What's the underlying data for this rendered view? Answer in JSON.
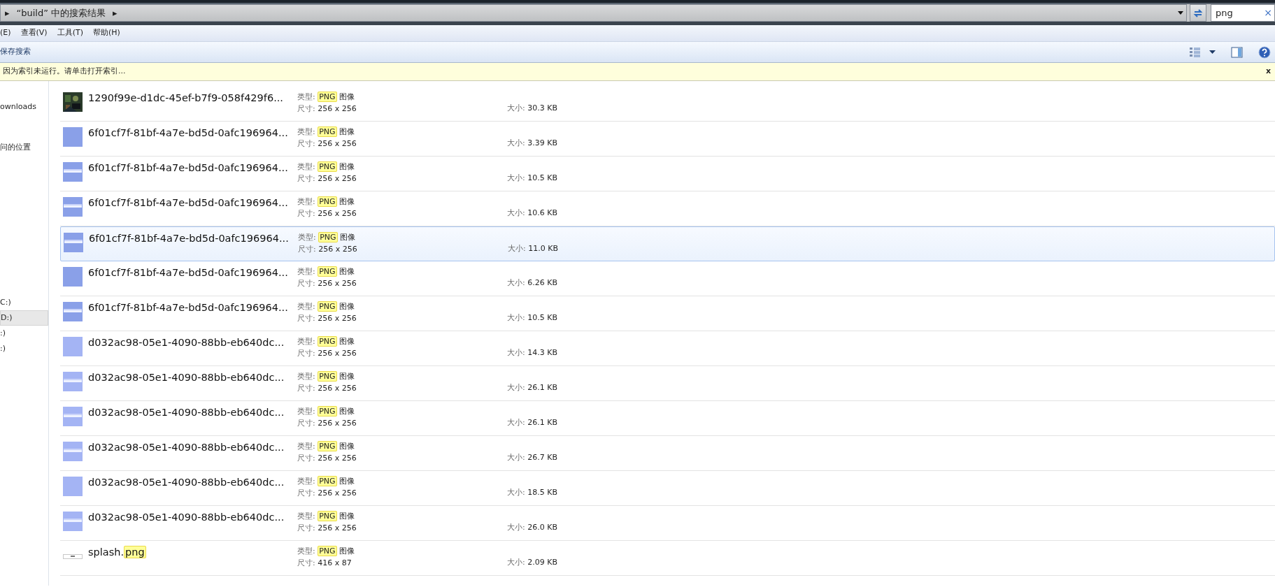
{
  "address": {
    "arrow_left": "▸",
    "text": "“build” 中的搜索结果",
    "arrow_right": "▸"
  },
  "search": {
    "value": "png",
    "clear": "×"
  },
  "menu": [
    "(E)",
    "查看(V)",
    "工具(T)",
    "帮助(H)"
  ],
  "toolbar": {
    "save_search": "保存搜索"
  },
  "info_bar": {
    "text": "因为索引未运行。请单击打开索引...",
    "close": "x"
  },
  "sidebar": [
    {
      "label": "ownloads",
      "selected": false,
      "gap": false
    },
    {
      "label": "问的位置",
      "selected": false,
      "gap": true
    },
    {
      "label": "C:)",
      "selected": false,
      "gap": true
    },
    {
      "label": "D:)",
      "selected": true,
      "gap": false
    },
    {
      "label": ":)",
      "selected": false,
      "gap": false
    },
    {
      "label": ":)",
      "selected": false,
      "gap": false
    }
  ],
  "files": [
    {
      "selected": false,
      "name_parts": [
        {
          "text": "1290f99e-d1dc-45ef-b7f9-058f429f6...",
          "highlighted": false
        }
      ],
      "type_label": "类型:",
      "type_parts": [
        {
          "text": "PNG",
          "highlighted": true
        },
        {
          "text": "图像",
          "highlighted": false
        }
      ],
      "dim_label": "尺寸:",
      "dims": "256 x 256",
      "size_label": "大小:",
      "size": "30.3 KB"
    },
    {
      "kind": "plain",
      "color": "#8aa0e8",
      "selected": false,
      "name_parts": [
        {
          "text": "6f01cf7f-81bf-4a7e-bd5d-0afc196964...",
          "highlighted": false
        }
      ],
      "type_label": "类型:",
      "type_parts": [
        {
          "text": "PNG",
          "highlighted": true
        },
        {
          "text": "图像",
          "highlighted": false
        }
      ],
      "dim_label": "尺寸:",
      "dims": "256 x 256",
      "size_label": "大小:",
      "size": "3.39 KB"
    },
    {
      "kind": "striped",
      "color": "#8aa0e8",
      "selected": false,
      "name_parts": [
        {
          "text": "6f01cf7f-81bf-4a7e-bd5d-0afc196964...",
          "highlighted": false
        }
      ],
      "type_label": "类型:",
      "type_parts": [
        {
          "text": "PNG",
          "highlighted": true
        },
        {
          "text": "图像",
          "highlighted": false
        }
      ],
      "dim_label": "尺寸:",
      "dims": "256 x 256",
      "size_label": "大小:",
      "size": "10.5 KB"
    },
    {
      "kind": "striped",
      "color": "#8aa0e8",
      "selected": false,
      "name_parts": [
        {
          "text": "6f01cf7f-81bf-4a7e-bd5d-0afc196964...",
          "highlighted": false
        }
      ],
      "type_label": "类型:",
      "type_parts": [
        {
          "text": "PNG",
          "highlighted": true
        },
        {
          "text": "图像",
          "highlighted": false
        }
      ],
      "dim_label": "尺寸:",
      "dims": "256 x 256",
      "size_label": "大小:",
      "size": "10.6 KB"
    },
    {
      "kind": "striped",
      "color": "#8aa0e8",
      "selected": true,
      "name_parts": [
        {
          "text": "6f01cf7f-81bf-4a7e-bd5d-0afc196964...",
          "highlighted": false
        }
      ],
      "type_label": "类型:",
      "type_parts": [
        {
          "text": "PNG",
          "highlighted": true
        },
        {
          "text": "图像",
          "highlighted": false
        }
      ],
      "dim_label": "尺寸:",
      "dims": "256 x 256",
      "size_label": "大小:",
      "size": "11.0 KB"
    },
    {
      "kind": "plain",
      "color": "#8aa0e8",
      "selected": false,
      "name_parts": [
        {
          "text": "6f01cf7f-81bf-4a7e-bd5d-0afc196964...",
          "highlighted": false
        }
      ],
      "type_label": "类型:",
      "type_parts": [
        {
          "text": "PNG",
          "highlighted": true
        },
        {
          "text": "图像",
          "highlighted": false
        }
      ],
      "dim_label": "尺寸:",
      "dims": "256 x 256",
      "size_label": "大小:",
      "size": "6.26 KB"
    },
    {
      "kind": "striped",
      "color": "#8aa0e8",
      "selected": false,
      "name_parts": [
        {
          "text": "6f01cf7f-81bf-4a7e-bd5d-0afc196964...",
          "highlighted": false
        }
      ],
      "type_label": "类型:",
      "type_parts": [
        {
          "text": "PNG",
          "highlighted": true
        },
        {
          "text": "图像",
          "highlighted": false
        }
      ],
      "dim_label": "尺寸:",
      "dims": "256 x 256",
      "size_label": "大小:",
      "size": "10.5 KB"
    },
    {
      "kind": "plain",
      "color": "#a4b4f4",
      "selected": false,
      "name_parts": [
        {
          "text": "d032ac98-05e1-4090-88bb-eb640dc...",
          "highlighted": false
        }
      ],
      "type_label": "类型:",
      "type_parts": [
        {
          "text": "PNG",
          "highlighted": true
        },
        {
          "text": "图像",
          "highlighted": false
        }
      ],
      "dim_label": "尺寸:",
      "dims": "256 x 256",
      "size_label": "大小:",
      "size": "14.3 KB"
    },
    {
      "kind": "striped",
      "color": "#a4b4f4",
      "selected": false,
      "name_parts": [
        {
          "text": "d032ac98-05e1-4090-88bb-eb640dc...",
          "highlighted": false
        }
      ],
      "type_label": "类型:",
      "type_parts": [
        {
          "text": "PNG",
          "highlighted": true
        },
        {
          "text": "图像",
          "highlighted": false
        }
      ],
      "dim_label": "尺寸:",
      "dims": "256 x 256",
      "size_label": "大小:",
      "size": "26.1 KB"
    },
    {
      "kind": "striped",
      "color": "#a4b4f4",
      "selected": false,
      "name_parts": [
        {
          "text": "d032ac98-05e1-4090-88bb-eb640dc...",
          "highlighted": false
        }
      ],
      "type_label": "类型:",
      "type_parts": [
        {
          "text": "PNG",
          "highlighted": true
        },
        {
          "text": "图像",
          "highlighted": false
        }
      ],
      "dim_label": "尺寸:",
      "dims": "256 x 256",
      "size_label": "大小:",
      "size": "26.1 KB"
    },
    {
      "kind": "striped",
      "color": "#a4b4f4",
      "selected": false,
      "name_parts": [
        {
          "text": "d032ac98-05e1-4090-88bb-eb640dc...",
          "highlighted": false
        }
      ],
      "type_label": "类型:",
      "type_parts": [
        {
          "text": "PNG",
          "highlighted": true
        },
        {
          "text": "图像",
          "highlighted": false
        }
      ],
      "dim_label": "尺寸:",
      "dims": "256 x 256",
      "size_label": "大小:",
      "size": "26.7 KB"
    },
    {
      "kind": "plain",
      "color": "#a4b4f4",
      "selected": false,
      "name_parts": [
        {
          "text": "d032ac98-05e1-4090-88bb-eb640dc...",
          "highlighted": false
        }
      ],
      "type_label": "类型:",
      "type_parts": [
        {
          "text": "PNG",
          "highlighted": true
        },
        {
          "text": "图像",
          "highlighted": false
        }
      ],
      "dim_label": "尺寸:",
      "dims": "256 x 256",
      "size_label": "大小:",
      "size": "18.5 KB"
    },
    {
      "kind": "striped",
      "color": "#a4b4f4",
      "selected": false,
      "name_parts": [
        {
          "text": "d032ac98-05e1-4090-88bb-eb640dc...",
          "highlighted": false
        }
      ],
      "type_label": "类型:",
      "type_parts": [
        {
          "text": "PNG",
          "highlighted": true
        },
        {
          "text": "图像",
          "highlighted": false
        }
      ],
      "dim_label": "尺寸:",
      "dims": "256 x 256",
      "size_label": "大小:",
      "size": "26.0 KB"
    },
    {
      "kind": "strip",
      "selected": false,
      "name_parts": [
        {
          "text": "splash.",
          "highlighted": false
        },
        {
          "text": "png",
          "highlighted": true
        }
      ],
      "type_label": "类型:",
      "type_parts": [
        {
          "text": "PNG",
          "highlighted": true
        },
        {
          "text": "图像",
          "highlighted": false
        }
      ],
      "dim_label": "尺寸:",
      "dims": "416 x 87",
      "size_label": "大小:",
      "size": "2.09 KB"
    }
  ]
}
